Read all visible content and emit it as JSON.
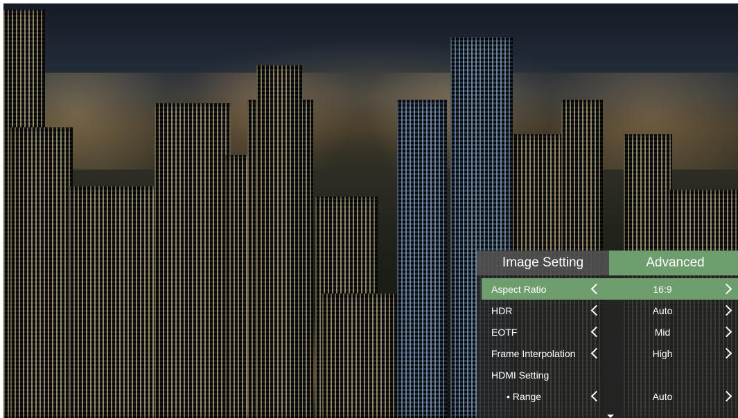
{
  "menu": {
    "tabs": [
      {
        "label": "Image Setting"
      },
      {
        "label": "Advanced"
      }
    ],
    "rows": [
      {
        "label": "Aspect Ratio",
        "value": "16:9"
      },
      {
        "label": "HDR",
        "value": "Auto"
      },
      {
        "label": "EOTF",
        "value": "Mid"
      },
      {
        "label": "Frame Interpolation",
        "value": "High"
      },
      {
        "label": "HDMI Setting"
      },
      {
        "label": "• Range",
        "value": "Auto"
      }
    ]
  },
  "icons": {
    "left": "chevron-left-icon",
    "right": "chevron-right-icon",
    "more": "arrow-down-icon"
  },
  "colors": {
    "accent": "#6f9e6e",
    "panel": "#3a3a3a"
  }
}
